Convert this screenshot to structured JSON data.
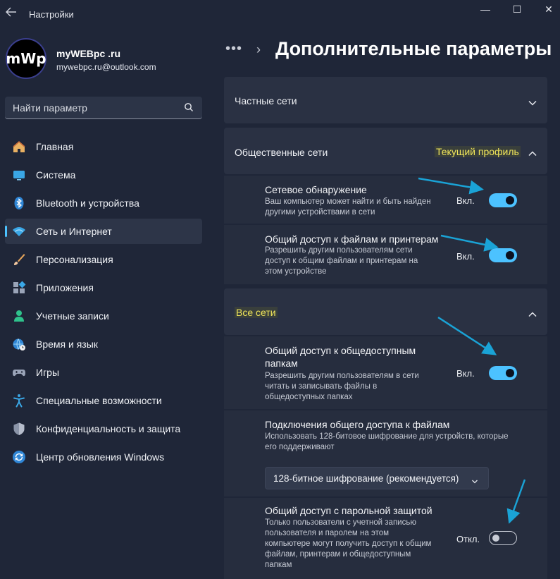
{
  "app": {
    "title": "Настройки",
    "window_controls": {
      "minimize": "—",
      "maximize": "☐",
      "close": "✕"
    }
  },
  "user": {
    "avatar_text": "mWp",
    "name": "myWEBpc .ru",
    "email": "mywebpc.ru@outlook.com"
  },
  "search": {
    "placeholder": "Найти параметр"
  },
  "sidebar": {
    "items": [
      {
        "label": "Главная",
        "icon": "home-icon"
      },
      {
        "label": "Система",
        "icon": "monitor-icon"
      },
      {
        "label": "Bluetooth и устройства",
        "icon": "bluetooth-icon"
      },
      {
        "label": "Сеть и Интернет",
        "icon": "wifi-icon",
        "active": true
      },
      {
        "label": "Персонализация",
        "icon": "brush-icon"
      },
      {
        "label": "Приложения",
        "icon": "apps-icon"
      },
      {
        "label": "Учетные записи",
        "icon": "person-icon"
      },
      {
        "label": "Время и язык",
        "icon": "globe-clock-icon"
      },
      {
        "label": "Игры",
        "icon": "gamepad-icon"
      },
      {
        "label": "Специальные возможности",
        "icon": "accessibility-icon"
      },
      {
        "label": "Конфиденциальность и защита",
        "icon": "shield-icon"
      },
      {
        "label": "Центр обновления Windows",
        "icon": "update-icon"
      }
    ]
  },
  "breadcrumb": {
    "dots": "•••",
    "separator": "›"
  },
  "page": {
    "title": "Дополнительные параметры"
  },
  "sections": {
    "private": {
      "title": "Частные сети"
    },
    "public": {
      "title": "Общественные сети",
      "badge": "Текущий профиль",
      "rows": [
        {
          "title": "Сетевое обнаружение",
          "desc_lines": [
            "Ваш компьютер может найти и быть найден",
            "другими устройствами в сети"
          ],
          "state": "Вкл.",
          "on": true
        },
        {
          "title": "Общий доступ к файлам и принтерам",
          "desc_lines": [
            "Разрешить другим пользователям сети",
            "доступ к общим файлам и принтерам на",
            "этом устройстве"
          ],
          "state": "Вкл.",
          "on": true
        }
      ]
    },
    "all": {
      "title": "Все сети",
      "rows": [
        {
          "title_lines": [
            "Общий доступ к общедоступным",
            "папкам"
          ],
          "desc_lines": [
            "Разрешить другим пользователям в сети",
            "читать и записывать файлы в",
            "общедоступных папках"
          ],
          "state": "Вкл.",
          "on": true
        },
        {
          "title": "Подключения общего доступа к файлам",
          "desc_lines": [
            "Использовать 128-битовое шифрование для устройств, которые",
            "его поддерживают"
          ],
          "dropdown": "128-битное шифрование (рекомендуется)"
        },
        {
          "title": "Общий доступ с парольной защитой",
          "desc_lines": [
            "Только пользователи с учетной записью",
            "пользователя и паролем на этом",
            "компьютере могут получить доступ к общим",
            "файлам, принтерам и общедоступным",
            "папкам"
          ],
          "state": "Откл.",
          "on": false
        }
      ]
    }
  },
  "colors": {
    "accent": "#4cc2ff",
    "background": "#1f2638",
    "card": "#2a3143",
    "annotation_arrow": "#1aa3d6",
    "highlight_text": "#f0e55a"
  }
}
